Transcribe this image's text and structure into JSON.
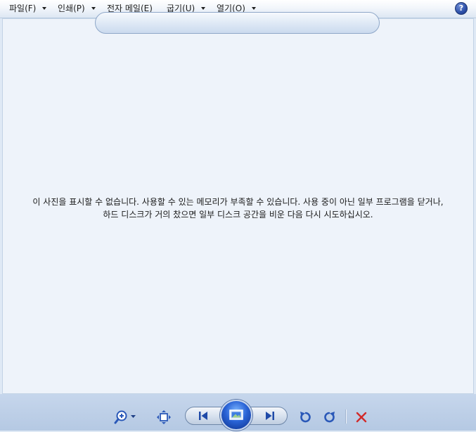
{
  "menu": {
    "items": [
      {
        "label": "파일(F)"
      },
      {
        "label": "인쇄(P)"
      },
      {
        "label": "전자 메일(E)"
      },
      {
        "label": "굽기(U)"
      },
      {
        "label": "열기(O)"
      }
    ],
    "help_icon": "help-icon"
  },
  "viewer": {
    "message_line1": "이 사진을 표시할 수 없습니다. 사용할 수 있는 메모리가 부족할 수 있습니다. 사용 중이 아닌 일부 프로그램을 닫거나,",
    "message_line2": "하드 디스크가 거의 찼으면 일부 디스크 공간을 비운 다음 다시 시도하십시오."
  },
  "toolbar": {
    "icons": [
      "zoom-icon",
      "actual-size-icon",
      "previous-icon",
      "slideshow-icon",
      "next-icon",
      "rotate-counterclockwise-icon",
      "rotate-clockwise-icon",
      "delete-icon"
    ],
    "colors": {
      "icon_blue": "#2a58b8",
      "delete_red": "#d12b2b"
    }
  }
}
